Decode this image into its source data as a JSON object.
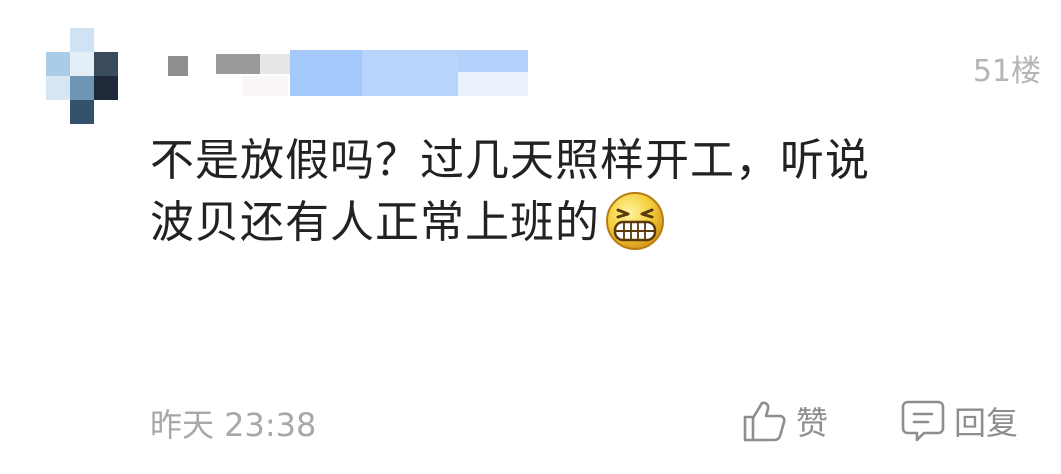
{
  "comment": {
    "floor": "51楼",
    "content_lines": [
      "不是放假吗？过几天照样开工，听说",
      "波贝还有人正常上班的"
    ],
    "emoji": "grinning-face-emoji",
    "time": "昨天 23:38",
    "actions": {
      "like_label": "赞",
      "reply_label": "回复"
    }
  },
  "colors": {
    "text": "#222222",
    "meta": "#a8a8a8",
    "username_highlight": "#a6c9fb"
  }
}
